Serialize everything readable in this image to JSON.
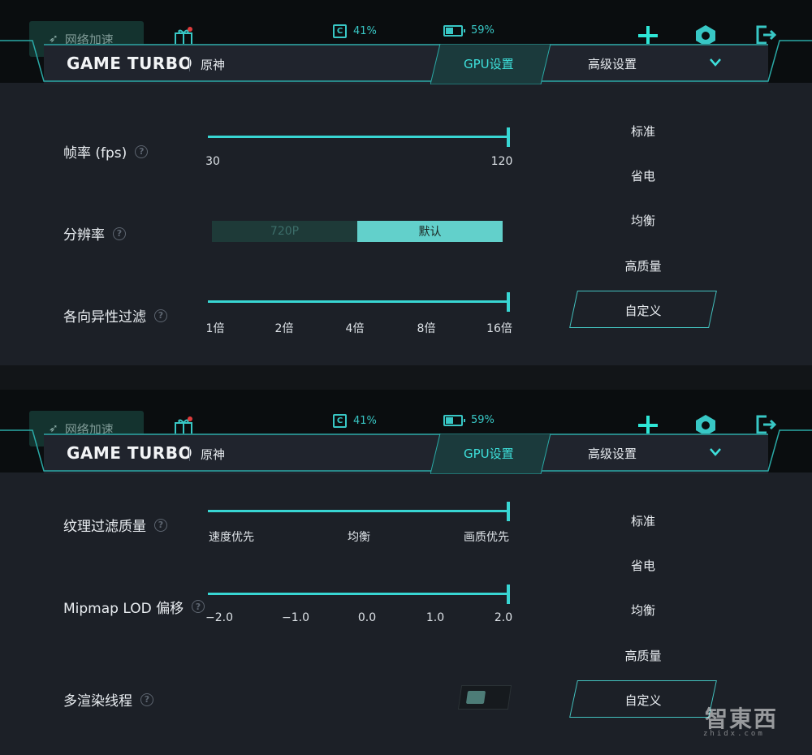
{
  "header": {
    "network_accel": "网络加速",
    "cpu": "41%",
    "cpu_glyph": "C",
    "battery": "59%",
    "game_title": "GAME TURBO",
    "game_name": "原神",
    "tabs": [
      {
        "label": "GPU设置",
        "active": true
      },
      {
        "label": "高级设置",
        "active": false
      }
    ]
  },
  "presets": [
    "标准",
    "省电",
    "均衡",
    "高质量",
    "自定义"
  ],
  "panel_top": {
    "framerate": {
      "label": "帧率 (fps)",
      "ticks": [
        "30",
        "120"
      ],
      "value": "120"
    },
    "resolution": {
      "label": "分辨率",
      "options": [
        "720P",
        "默认"
      ],
      "selected": "默认"
    },
    "anisotropic": {
      "label": "各向异性过滤",
      "ticks": [
        "1倍",
        "2倍",
        "4倍",
        "8倍",
        "16倍"
      ],
      "value": "16倍"
    }
  },
  "panel_bottom": {
    "texture_filter": {
      "label": "纹理过滤质量",
      "ticks": [
        "速度优先",
        "均衡",
        "画质优先"
      ],
      "value": "画质优先"
    },
    "mipmap": {
      "label": "Mipmap LOD 偏移",
      "ticks": [
        "−2.0",
        "−1.0",
        "0.0",
        "1.0",
        "2.0"
      ],
      "value": "2.0"
    },
    "multithread": {
      "label": "多渲染线程",
      "enabled": false
    }
  },
  "watermark": {
    "text": "智東西",
    "sub": "zhidx.com"
  },
  "colors": {
    "accent": "#38d6d3",
    "background": "#1c2027",
    "header": "#20242d"
  },
  "icons": [
    "rocket-icon",
    "gift-icon",
    "cpu-icon",
    "battery-icon",
    "plus-icon",
    "hex-icon",
    "exit-icon",
    "chevron-down-icon",
    "help-icon"
  ]
}
